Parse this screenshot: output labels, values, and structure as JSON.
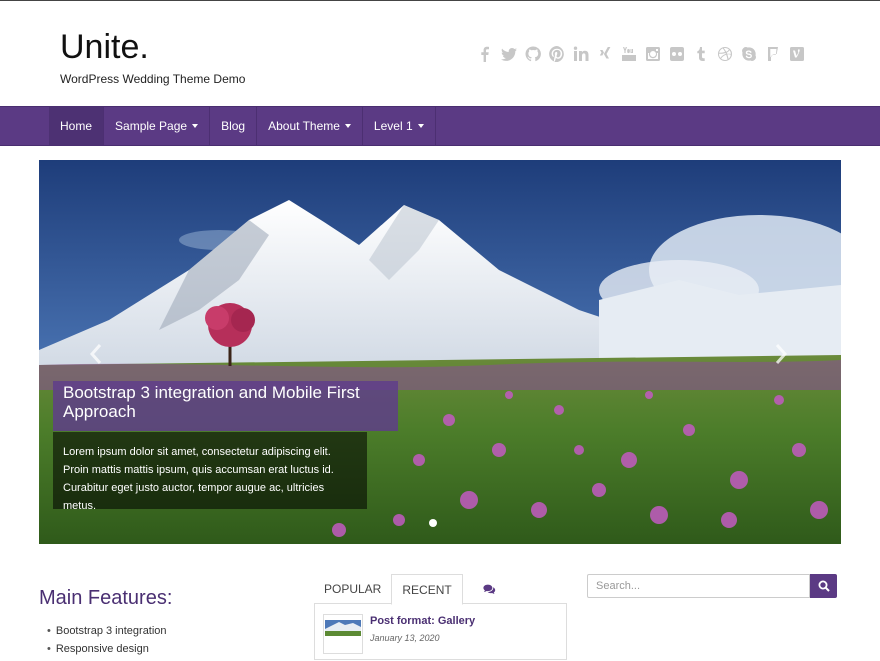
{
  "site": {
    "title": "Unite.",
    "description": "WordPress Wedding Theme Demo"
  },
  "social_icons": [
    "facebook-icon",
    "twitter-icon",
    "github-icon",
    "pinterest-icon",
    "linkedin-icon",
    "xing-icon",
    "youtube-icon",
    "instagram-icon",
    "flickr-icon",
    "tumblr-icon",
    "dribbble-icon",
    "skype-icon",
    "foursquare-icon",
    "vine-icon"
  ],
  "nav": {
    "items": [
      {
        "label": "Home",
        "active": true,
        "dropdown": false
      },
      {
        "label": "Sample Page",
        "active": false,
        "dropdown": true
      },
      {
        "label": "Blog",
        "active": false,
        "dropdown": false
      },
      {
        "label": "About Theme",
        "active": false,
        "dropdown": true
      },
      {
        "label": "Level 1",
        "active": false,
        "dropdown": true
      }
    ]
  },
  "slider": {
    "caption_title": "Bootstrap 3 integration and Mobile First Approach",
    "caption_text": "Lorem ipsum dolor sit amet, consectetur adipiscing elit. Proin mattis mattis ipsum, quis accumsan erat luctus id. Curabitur eget justo auctor, tempor augue ac, ultricies metus.",
    "prev_icon": "chevron-left-icon",
    "next_icon": "chevron-right-icon"
  },
  "features": {
    "title": "Main Features:",
    "items": [
      "Bootstrap 3 integration",
      "Responsive design"
    ]
  },
  "tabs": {
    "items": [
      {
        "label": "POPULAR",
        "active": false
      },
      {
        "label": "RECENT",
        "active": true
      },
      {
        "icon": "comments-icon",
        "active": false
      }
    ],
    "post": {
      "title": "Post format: Gallery",
      "date": "January 13, 2020"
    }
  },
  "search": {
    "placeholder": "Search...",
    "icon": "search-icon"
  },
  "colors": {
    "accent": "#5b3a84",
    "nav_active": "#4d3173",
    "link": "#4a2f72"
  }
}
